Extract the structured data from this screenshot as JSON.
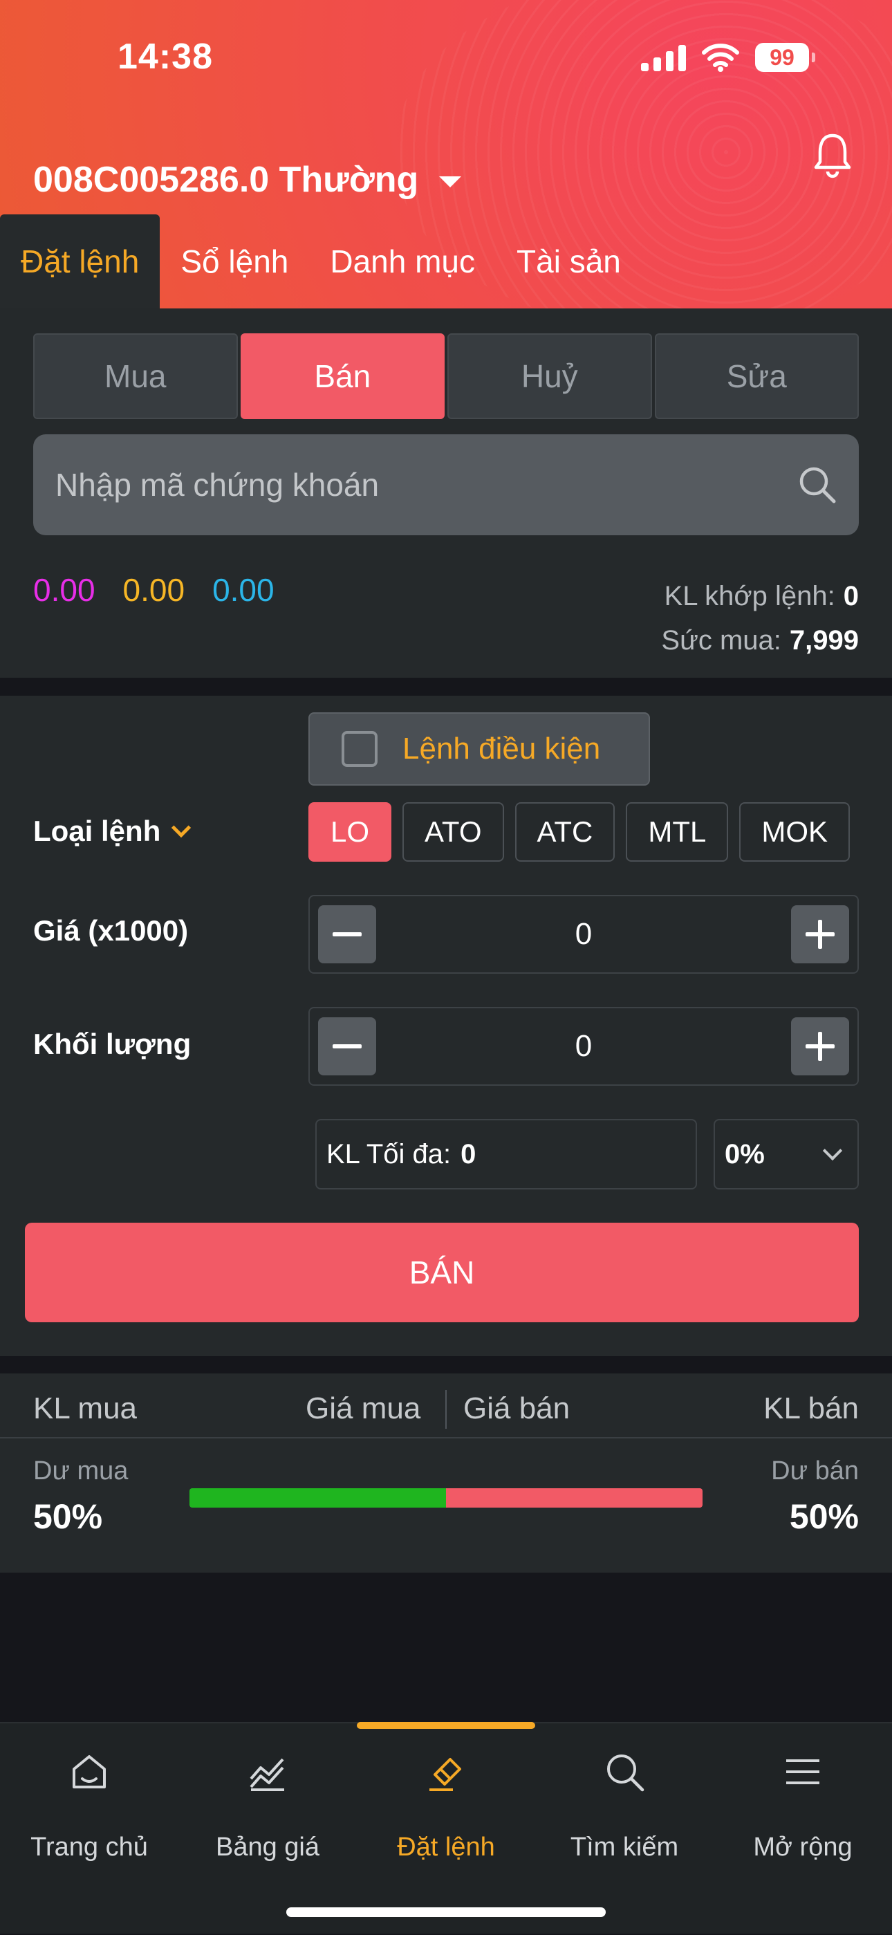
{
  "status_bar": {
    "time": "14:38",
    "battery": "99"
  },
  "header": {
    "account": "008C005286.0 Thường"
  },
  "tabs": [
    {
      "label": "Đặt lệnh",
      "active": true
    },
    {
      "label": "Sổ lệnh",
      "active": false
    },
    {
      "label": "Danh mục",
      "active": false
    },
    {
      "label": "Tài sản",
      "active": false
    }
  ],
  "actions": {
    "buy": "Mua",
    "sell": "Bán",
    "cancel": "Huỷ",
    "edit": "Sửa",
    "selected": "Bán"
  },
  "search": {
    "placeholder": "Nhập mã chứng khoán"
  },
  "prices": {
    "ceiling": "0.00",
    "reference": "0.00",
    "floor": "0.00"
  },
  "stats": {
    "matched_label": "KL khớp lệnh:",
    "matched_value": "0",
    "power_label": "Sức mua:",
    "power_value": "7,999"
  },
  "order": {
    "conditional_label": "Lệnh điều kiện",
    "type_label": "Loại lệnh",
    "types": [
      "LO",
      "ATO",
      "ATC",
      "MTL",
      "MOK"
    ],
    "selected_type": "LO",
    "price_label": "Giá (x1000)",
    "price_value": "0",
    "qty_label": "Khối lượng",
    "qty_value": "0",
    "max_label": "KL Tối đa:",
    "max_value": "0",
    "percent": "0%",
    "submit_label": "BÁN"
  },
  "orderbook": {
    "buy_qty": "KL mua",
    "buy_price": "Giá mua",
    "sell_price": "Giá bán",
    "sell_qty": "KL bán",
    "buy_surplus_label": "Dư mua",
    "buy_surplus": "50%",
    "sell_surplus_label": "Dư bán",
    "sell_surplus": "50%",
    "buy_ratio": 0.5
  },
  "colors": {
    "accent": "#f6a926",
    "sell": "#f25a66",
    "buy_bar": "#1fb51f",
    "ceiling": "#e82ee8",
    "reference": "#f6b626",
    "floor": "#2bb5e8"
  },
  "bottom_nav": [
    {
      "label": "Trang chủ",
      "icon": "home-icon"
    },
    {
      "label": "Bảng giá",
      "icon": "chart-icon"
    },
    {
      "label": "Đặt lệnh",
      "icon": "order-icon",
      "active": true
    },
    {
      "label": "Tìm kiếm",
      "icon": "search-icon"
    },
    {
      "label": "Mở rộng",
      "icon": "menu-icon"
    }
  ]
}
